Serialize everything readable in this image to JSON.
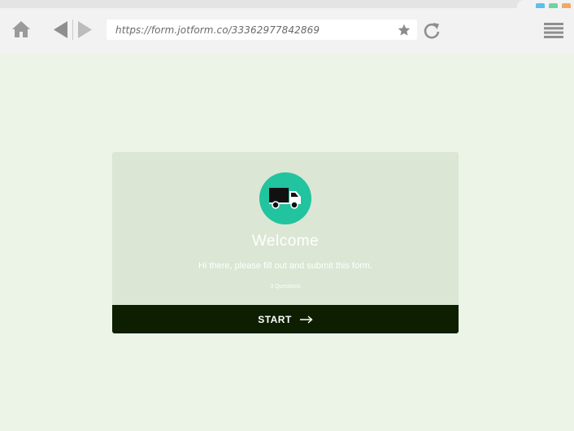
{
  "browser": {
    "url": "https://form.jotform.co/33362977842869",
    "window_button_colors": [
      "#5bc0eb",
      "#6fd3a0",
      "#f0a868"
    ]
  },
  "form": {
    "icon": "truck-icon",
    "title": "Welcome",
    "subtitle": "Hi there, please fill out and submit this form.",
    "question_count": "3 Questions",
    "start_label": "START",
    "accent_color": "#22c39f",
    "button_color": "#0d1f00"
  }
}
